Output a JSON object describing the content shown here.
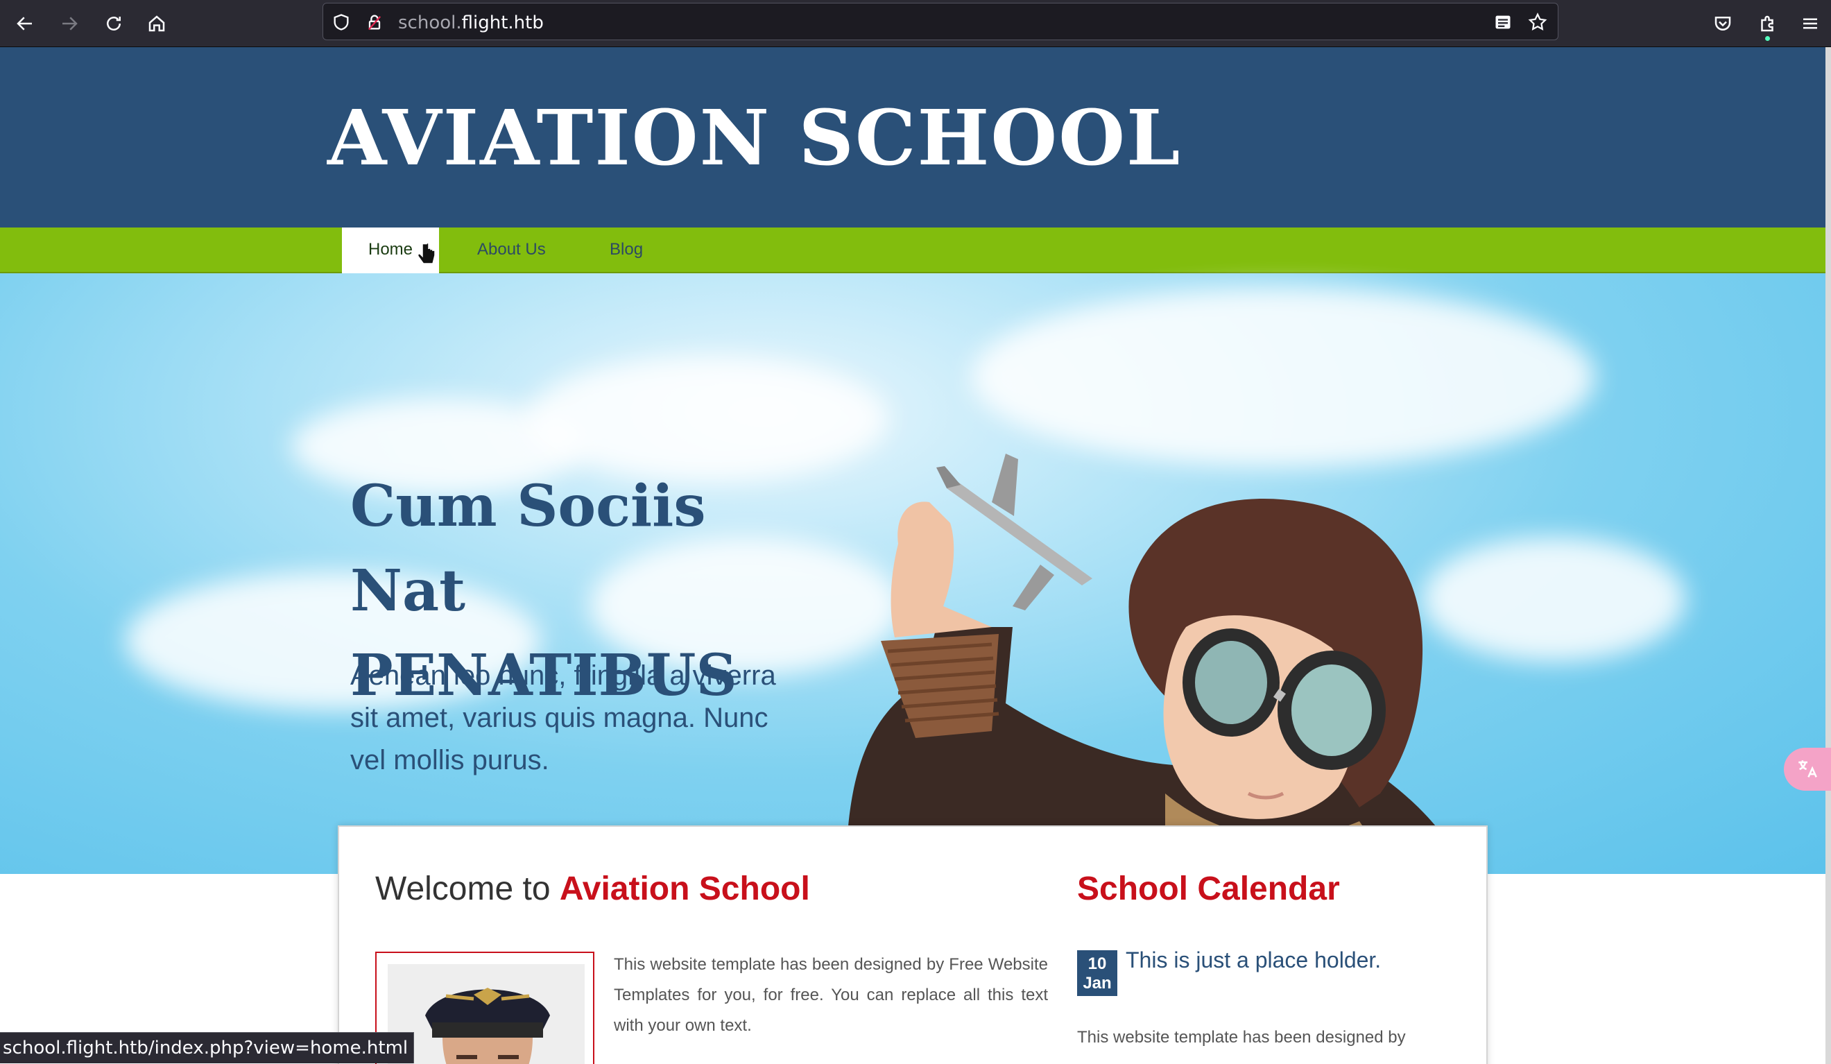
{
  "browser": {
    "url_host_prefix": "school.",
    "url_host_domain": "flight.htb",
    "status_url": "school.flight.htb/index.php?view=home.html",
    "icons": [
      "back-icon",
      "forward-icon",
      "reload-icon",
      "home-icon",
      "shield-icon",
      "lock-icon",
      "reader-view-icon",
      "bookmark-star-icon",
      "pocket-icon",
      "extensions-icon",
      "menu-icon",
      "translate-icon"
    ]
  },
  "site": {
    "title": "AVIATION SCHOOL",
    "nav": [
      {
        "label": "Home",
        "active": true
      },
      {
        "label": "About Us",
        "active": false
      },
      {
        "label": "Blog",
        "active": false
      }
    ]
  },
  "hero": {
    "heading_line1": "Cum Sociis Nat",
    "heading_line2": "PENATIBUS",
    "text": "Aenean leo nunc, fringilla a viverra sit amet, varius quis magna. Nunc vel mollis purus."
  },
  "welcome": {
    "prefix": "Welcome to ",
    "accent": "Aviation School",
    "text": "This website template has been designed by Free Website Templates for you, for free. You can replace all this text with your own text."
  },
  "calendar": {
    "title": "School Calendar",
    "day": "10",
    "month": "Jan",
    "event": "This is just a place holder.",
    "text": "This website template has been designed by"
  },
  "colors": {
    "header_bg": "#2a5078",
    "nav_bg": "#82bd0d",
    "accent_red": "#c8101b",
    "browser_chrome": "#2b2a33"
  }
}
